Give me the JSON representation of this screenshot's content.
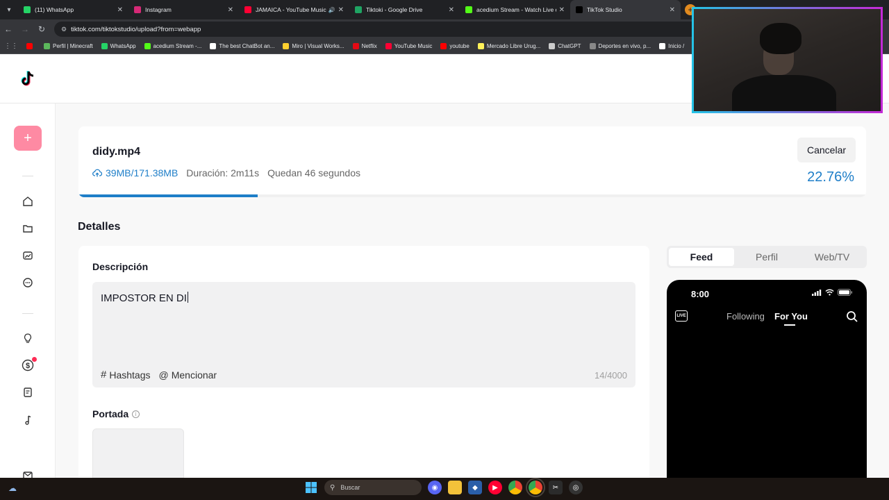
{
  "browser": {
    "tabs": [
      {
        "title": "(11) WhatsApp",
        "color": "#25d366",
        "speaker": false,
        "active": false
      },
      {
        "title": "Instagram",
        "color": "#d62976",
        "speaker": false,
        "active": false
      },
      {
        "title": "JAMAICA - YouTube Music",
        "color": "#ff0033",
        "speaker": true,
        "active": false
      },
      {
        "title": "Tiktoki - Google Drive",
        "color": "#1fa463",
        "speaker": false,
        "active": false
      },
      {
        "title": "acedium Stream - Watch Live o",
        "color": "#53fc18",
        "speaker": false,
        "active": false
      },
      {
        "title": "TikTok Studio",
        "color": "#000000",
        "speaker": false,
        "active": true
      }
    ],
    "url": "tiktok.com/tiktokstudio/upload?from=webapp",
    "bookmarks": [
      {
        "label": "",
        "color": "#ff0000"
      },
      {
        "label": "Perfil | Minecraft",
        "color": "#5cb85c"
      },
      {
        "label": "WhatsApp",
        "color": "#25d366"
      },
      {
        "label": "acedium Stream -...",
        "color": "#53fc18"
      },
      {
        "label": "The best ChatBot an...",
        "color": "#ffffff"
      },
      {
        "label": "Miro | Visual Works...",
        "color": "#ffd02f"
      },
      {
        "label": "Netflix",
        "color": "#e50914"
      },
      {
        "label": "YouTube Music",
        "color": "#ff0033"
      },
      {
        "label": "youtube",
        "color": "#ff0000"
      },
      {
        "label": "Mercado Libre Urug...",
        "color": "#fff159"
      },
      {
        "label": "ChatGPT",
        "color": "#cccccc"
      },
      {
        "label": "Deportes en vivo, p...",
        "color": "#888888"
      },
      {
        "label": "Inicio /",
        "color": "#ffffff"
      }
    ]
  },
  "upload": {
    "filename": "didy.mp4",
    "size": "39MB/171.38MB",
    "duration": "Duración: 2m11s",
    "remaining": "Quedan 46 segundos",
    "cancel_label": "Cancelar",
    "percent_text": "22.76%",
    "progress": 0.2276
  },
  "details": {
    "heading": "Detalles",
    "description_label": "Descripción",
    "description_value": "IMPOSTOR EN DI",
    "hashtags_label": "Hashtags",
    "mention_label": "Mencionar",
    "counter": "14/4000",
    "cover_label": "Portada"
  },
  "preview": {
    "tabs": [
      "Feed",
      "Perfil",
      "Web/TV"
    ],
    "active_tab": "Feed",
    "time": "8:00",
    "live_label": "LIVE",
    "following": "Following",
    "for_you": "For You"
  },
  "taskbar": {
    "search_placeholder": "Buscar"
  },
  "colors": {
    "accent_blue": "#1e7ec8",
    "upload_button": "#fe8aa3"
  }
}
